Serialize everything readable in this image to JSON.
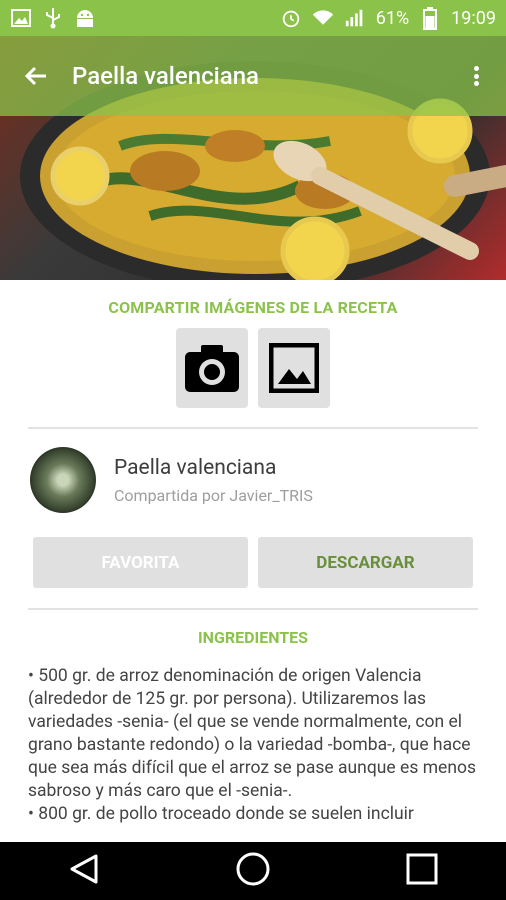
{
  "status_bar": {
    "battery": "61%",
    "time": "19:09",
    "icons": [
      "image-icon",
      "usb-icon",
      "android-icon",
      "alarm-icon",
      "wifi-icon",
      "signal-icon",
      "battery-icon"
    ]
  },
  "app_bar": {
    "title": "Paella valenciana",
    "icons": [
      "back-arrow-icon",
      "overflow-menu-icon"
    ]
  },
  "share": {
    "title": "COMPARTIR IMÁGENES DE LA RECETA",
    "buttons": [
      "camera-icon",
      "gallery-icon"
    ]
  },
  "recipe": {
    "name": "Paella valenciana",
    "shared_by": "Compartida por Javier_TRIS"
  },
  "actions": {
    "favorite": "FAVORITA",
    "download": "DESCARGAR"
  },
  "ingredients": {
    "title": "INGREDIENTES",
    "items": [
      "  • 500 gr. de arroz denominación de origen Valencia (alrededor de 125 gr. por persona). Utilizaremos las variedades -senia- (el que se vende normalmente, con el grano bastante redondo) o la variedad -bomba-, que hace que sea más difícil que el arroz se pase aunque es menos sabroso y más caro que el -senia-.",
      "  • 800 gr. de pollo troceado donde se suelen incluir"
    ]
  },
  "colors": {
    "accent": "#8bc34a",
    "button_bg": "#e0e0e0",
    "text": "#444444"
  },
  "nav": [
    "back-triangle-icon",
    "home-circle-icon",
    "recents-square-icon"
  ]
}
